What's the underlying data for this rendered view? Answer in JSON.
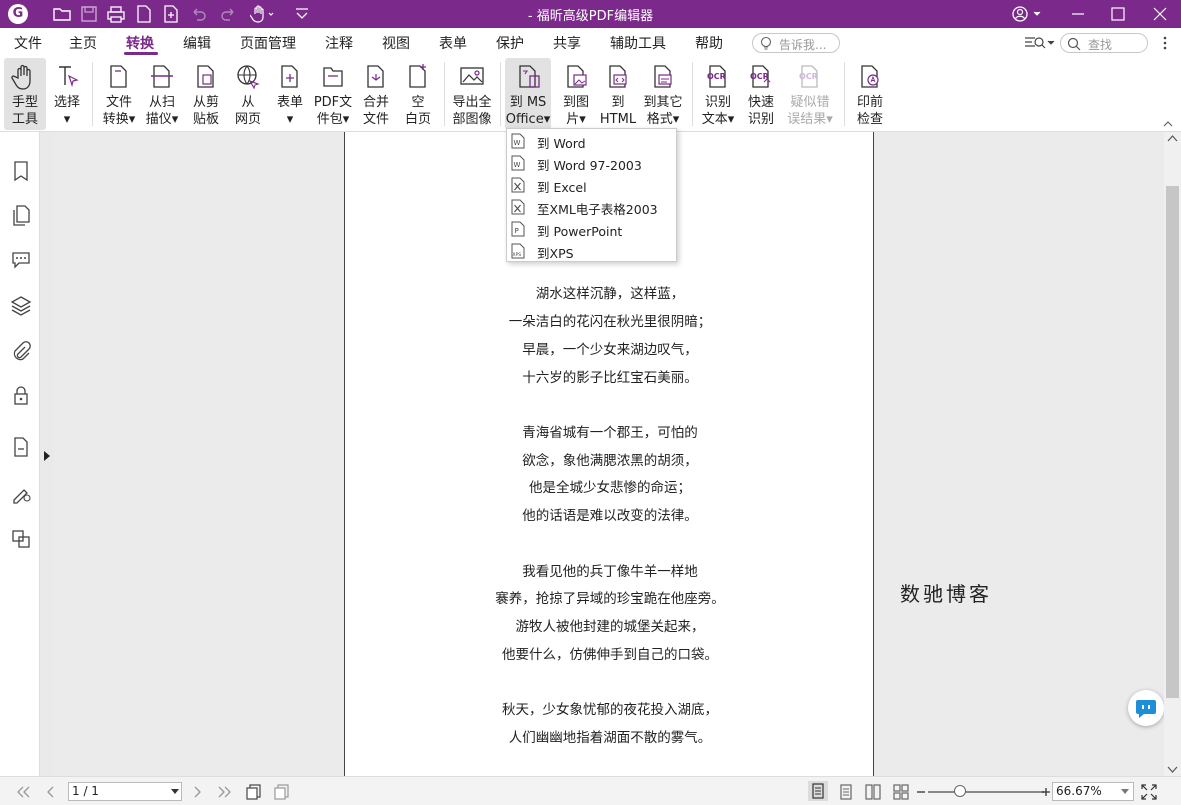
{
  "app": {
    "title": "- 福昕高级PDF编辑器",
    "accent_color": "#7b2a8b"
  },
  "menu": {
    "items": [
      "文件",
      "主页",
      "转换",
      "编辑",
      "页面管理",
      "注释",
      "视图",
      "表单",
      "保护",
      "共享",
      "辅助工具",
      "帮助"
    ],
    "active": "转换",
    "tell_me_placeholder": "告诉我...",
    "find_placeholder": "查找"
  },
  "ribbon": {
    "buttons": [
      {
        "label": "手型\n工具",
        "icon": "hand-icon"
      },
      {
        "label": "选择\n▾",
        "icon": "text-select-icon"
      },
      {
        "label": "文件\n转换▾",
        "icon": "file-convert-icon"
      },
      {
        "label": "从扫\n描仪▾",
        "icon": "scanner-icon"
      },
      {
        "label": "从剪\n贴板",
        "icon": "clipboard-icon"
      },
      {
        "label": "从\n网页",
        "icon": "web-icon"
      },
      {
        "label": "表单\n▾",
        "icon": "form-icon"
      },
      {
        "label": "PDF文\n件包▾",
        "icon": "portfolio-icon"
      },
      {
        "label": "合并\n文件",
        "icon": "merge-icon"
      },
      {
        "label": "空\n白页",
        "icon": "blank-page-icon"
      },
      {
        "label": "导出全\n部图像",
        "icon": "export-images-icon"
      },
      {
        "label": "到 MS\nOffice▾",
        "icon": "to-office-icon"
      },
      {
        "label": "到图\n片▾",
        "icon": "to-image-icon"
      },
      {
        "label": "到\nHTML",
        "icon": "to-html-icon"
      },
      {
        "label": "到其它\n格式▾",
        "icon": "to-other-icon"
      },
      {
        "label": "识别\n文本▾",
        "icon": "ocr-icon"
      },
      {
        "label": "快速\n识别",
        "icon": "quick-ocr-icon"
      },
      {
        "label": "疑似错\n误结果▾",
        "icon": "ocr-suspect-icon"
      },
      {
        "label": "印前\n检查",
        "icon": "preflight-icon"
      }
    ]
  },
  "dropdown": {
    "items": [
      {
        "label": "到 Word",
        "icon": "word-doc-icon"
      },
      {
        "label": "到 Word 97-2003",
        "icon": "word97-doc-icon"
      },
      {
        "label": "到 Excel",
        "icon": "excel-doc-icon"
      },
      {
        "label": "至XML电子表格2003",
        "icon": "xml-spreadsheet-icon"
      },
      {
        "label": "到 PowerPoint",
        "icon": "powerpoint-doc-icon"
      },
      {
        "label": "到XPS",
        "icon": "xps-doc-icon"
      }
    ]
  },
  "document": {
    "lines": [
      "湖水这样沉静，这样蓝，",
      "一朵洁白的花闪在秋光里很阴暗；",
      "早晨，一个少女来湖边叹气，",
      "十六岁的影子比红宝石美丽。",
      "青海省城有一个郡王，可怕的",
      "欲念，象他满腮浓黑的胡须，",
      "他是全城少女悲惨的命运；",
      "他的话语是难以改变的法律。",
      "我看见他的兵丁像牛羊一样地",
      "褰养，抢掠了异域的珍宝跪在他座旁。",
      "游牧人被他封建的城堡关起来，",
      "他要什么，仿佛伸手到自己的口袋。",
      "秋天，少女象忧郁的夜花投入湖底，",
      "人们幽幽地指着湖面不散的雾气。"
    ],
    "watermark": "数驰博客"
  },
  "status": {
    "page_indicator": "1 / 1",
    "zoom": "66.67%",
    "zoom_fraction": 0.28
  }
}
